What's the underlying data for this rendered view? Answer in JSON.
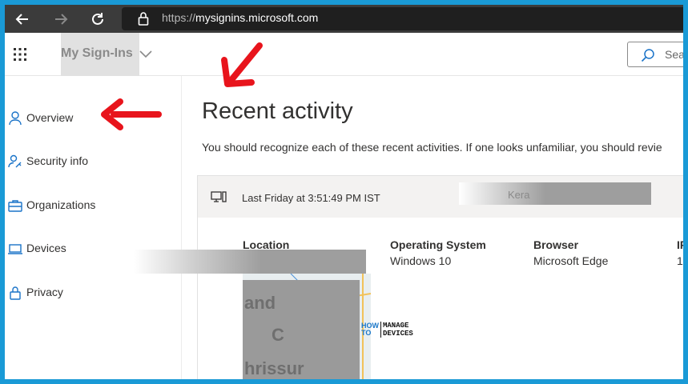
{
  "browser": {
    "url_scheme": "https://",
    "url_host": "mysignins.microsoft.com"
  },
  "app": {
    "title": "My Sign-Ins",
    "search_placeholder": "Sea"
  },
  "sidebar": {
    "items": [
      {
        "label": "Overview",
        "icon": "person-icon"
      },
      {
        "label": "Security info",
        "icon": "person-key-icon"
      },
      {
        "label": "Organizations",
        "icon": "briefcase-icon"
      },
      {
        "label": "Devices",
        "icon": "laptop-icon"
      },
      {
        "label": "Privacy",
        "icon": "lock-icon"
      }
    ]
  },
  "main": {
    "heading": "Recent activity",
    "description": "You should recognize each of these recent activities. If one looks unfamiliar, you should revie",
    "activity": {
      "time": "Last Friday at 3:51:49 PM IST",
      "redacted_label": "Kera",
      "columns": [
        {
          "header": "Location",
          "value": ""
        },
        {
          "header": "Operating System",
          "value": "Windows 10"
        },
        {
          "header": "Browser",
          "value": "Microsoft Edge"
        },
        {
          "header": "IF",
          "value": "1"
        }
      ],
      "map_labels": [
        "and",
        "C",
        "hrissur"
      ]
    }
  },
  "watermark": {
    "line1": "HOW",
    "line2": "TO",
    "line3": "MANAGE",
    "line4": "DEVICES"
  },
  "colors": {
    "frame": "#1a9ad6",
    "annotation_arrow": "#e8141c",
    "browser_bar": "#3b3b3b"
  }
}
